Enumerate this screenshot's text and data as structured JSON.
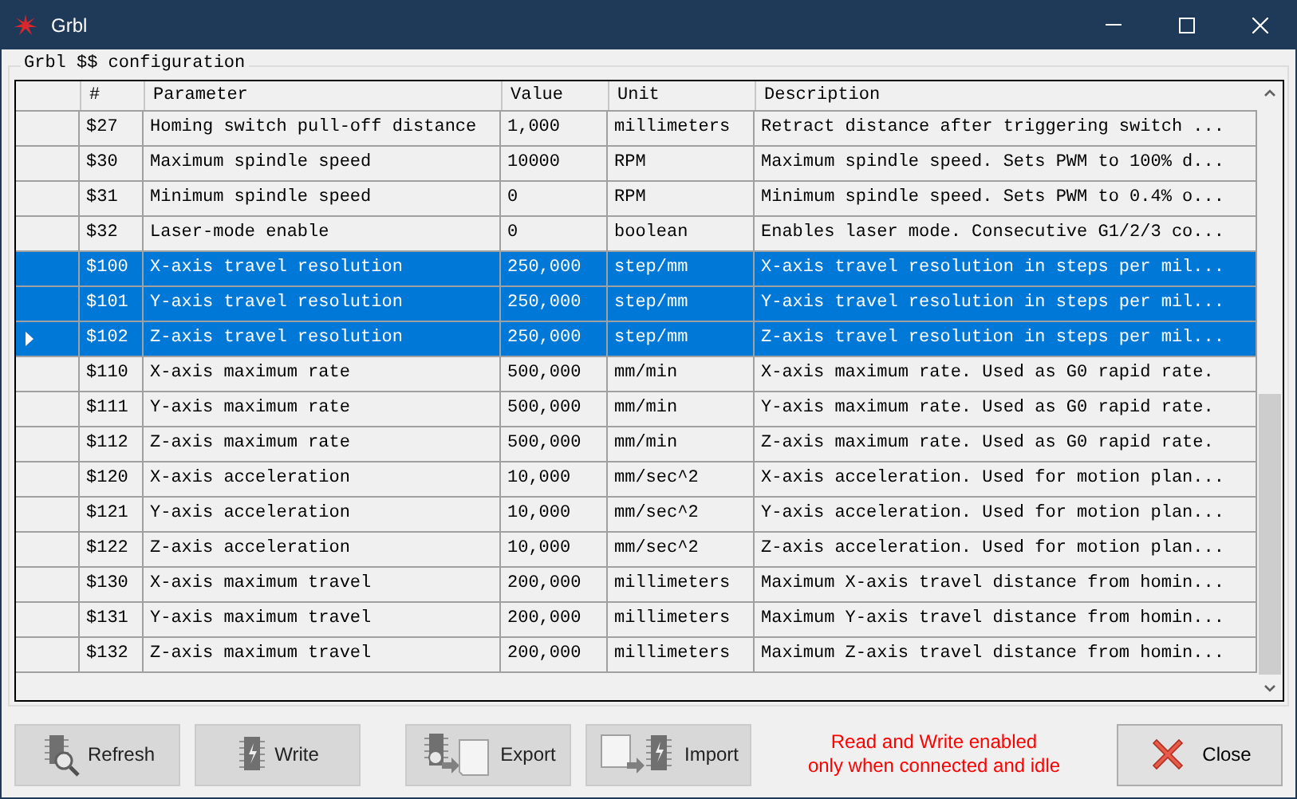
{
  "window": {
    "title": "Grbl"
  },
  "group": {
    "title": "Grbl $$ configuration"
  },
  "table": {
    "columns": [
      "#",
      "Parameter",
      "Value",
      "Unit",
      "Description"
    ],
    "rows": [
      {
        "cells": [
          "$27",
          "Homing switch pull-off distance",
          "1,000",
          "millimeters",
          "Retract distance after triggering switch ..."
        ],
        "selected": false,
        "current": false
      },
      {
        "cells": [
          "$30",
          "Maximum spindle speed",
          "10000",
          "RPM",
          "Maximum spindle speed. Sets PWM to 100% d..."
        ],
        "selected": false,
        "current": false
      },
      {
        "cells": [
          "$31",
          "Minimum spindle speed",
          "0",
          "RPM",
          "Minimum spindle speed. Sets PWM to 0.4% o..."
        ],
        "selected": false,
        "current": false
      },
      {
        "cells": [
          "$32",
          "Laser-mode enable",
          "0",
          "boolean",
          "Enables laser mode. Consecutive G1/2/3 co..."
        ],
        "selected": false,
        "current": false
      },
      {
        "cells": [
          "$100",
          "X-axis travel resolution",
          "250,000",
          "step/mm",
          "X-axis travel resolution in steps per mil..."
        ],
        "selected": true,
        "current": false
      },
      {
        "cells": [
          "$101",
          "Y-axis travel resolution",
          "250,000",
          "step/mm",
          "Y-axis travel resolution in steps per mil..."
        ],
        "selected": true,
        "current": false
      },
      {
        "cells": [
          "$102",
          "Z-axis travel resolution",
          "250,000",
          "step/mm",
          "Z-axis travel resolution in steps per mil..."
        ],
        "selected": true,
        "current": true
      },
      {
        "cells": [
          "$110",
          "X-axis maximum rate",
          "500,000",
          "mm/min",
          "X-axis maximum rate. Used as G0 rapid rate."
        ],
        "selected": false,
        "current": false
      },
      {
        "cells": [
          "$111",
          "Y-axis maximum rate",
          "500,000",
          "mm/min",
          "Y-axis maximum rate. Used as G0 rapid rate."
        ],
        "selected": false,
        "current": false
      },
      {
        "cells": [
          "$112",
          "Z-axis maximum rate",
          "500,000",
          "mm/min",
          "Z-axis maximum rate. Used as G0 rapid rate."
        ],
        "selected": false,
        "current": false
      },
      {
        "cells": [
          "$120",
          "X-axis acceleration",
          "10,000",
          "mm/sec^2",
          "X-axis acceleration. Used for motion plan..."
        ],
        "selected": false,
        "current": false
      },
      {
        "cells": [
          "$121",
          "Y-axis acceleration",
          "10,000",
          "mm/sec^2",
          "Y-axis acceleration. Used for motion plan..."
        ],
        "selected": false,
        "current": false
      },
      {
        "cells": [
          "$122",
          "Z-axis acceleration",
          "10,000",
          "mm/sec^2",
          "Z-axis acceleration. Used for motion plan..."
        ],
        "selected": false,
        "current": false
      },
      {
        "cells": [
          "$130",
          "X-axis maximum travel",
          "200,000",
          "millimeters",
          "Maximum X-axis travel distance from homin..."
        ],
        "selected": false,
        "current": false
      },
      {
        "cells": [
          "$131",
          "Y-axis maximum travel",
          "200,000",
          "millimeters",
          "Maximum Y-axis travel distance from homin..."
        ],
        "selected": false,
        "current": false
      },
      {
        "cells": [
          "$132",
          "Z-axis maximum travel",
          "200,000",
          "millimeters",
          "Maximum Z-axis travel distance from homin..."
        ],
        "selected": false,
        "current": false
      }
    ]
  },
  "buttons": [
    {
      "label": "Refresh",
      "kind": "refresh"
    },
    {
      "label": "Write",
      "kind": "write"
    },
    {
      "label": "Export",
      "kind": "export"
    },
    {
      "label": "Import",
      "kind": "import"
    }
  ],
  "notice": [
    "Read and Write enabled",
    "only when connected and idle"
  ],
  "close_button": {
    "label": "Close"
  }
}
